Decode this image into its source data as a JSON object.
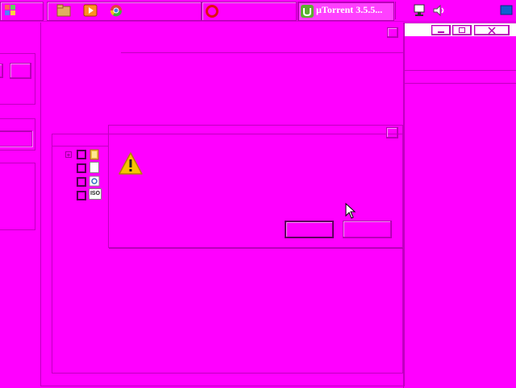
{
  "taskbar": {
    "utorrent_label": "µTorrent 3.5.5...",
    "icons": [
      "start-orb-icon",
      "file-explorer-icon",
      "media-player-icon",
      "chrome-icon",
      "opera-icon",
      "utorrent-icon",
      "network-icon",
      "volume-icon",
      "show-desktop-icon"
    ]
  },
  "colors": {
    "background": "#ff00ff",
    "border": "#c000c0",
    "warning": "#f5c400"
  },
  "dialog": {
    "icon": "warning-icon",
    "ok_label": "",
    "cancel_label": ""
  },
  "file_tree": {
    "items": [
      {
        "icon": "folder-icon"
      },
      {
        "icon": "blank-file-icon"
      },
      {
        "icon": "config-file-icon"
      },
      {
        "icon": "iso-file-icon",
        "text": "ISO"
      }
    ]
  }
}
